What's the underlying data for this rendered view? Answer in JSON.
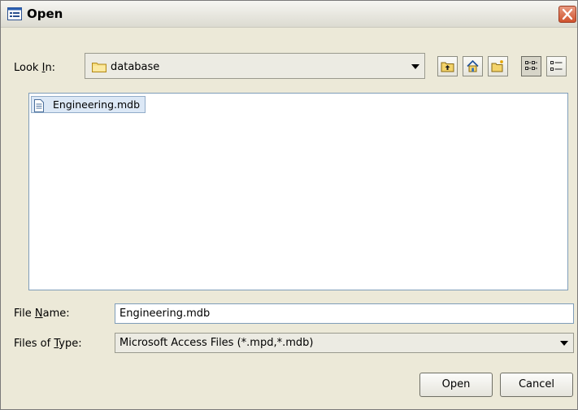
{
  "window": {
    "title": "Open",
    "title_icon": "open-dialog-icon",
    "close_icon": "close-icon"
  },
  "lookin": {
    "label_prefix": "Look ",
    "label_mnemonic": "I",
    "label_suffix": "n:",
    "value": "database",
    "icon": "folder-icon"
  },
  "toolbar": [
    {
      "name": "up-one-level",
      "icon": "up-folder-icon"
    },
    {
      "name": "home",
      "icon": "home-icon"
    },
    {
      "name": "create-new-folder",
      "icon": "new-folder-icon"
    },
    {
      "name": "list-view",
      "icon": "list-view-icon",
      "pressed": true
    },
    {
      "name": "details-view",
      "icon": "details-view-icon",
      "pressed": false
    }
  ],
  "files": [
    {
      "name": "Engineering.mdb",
      "icon": "document-icon",
      "selected": true
    }
  ],
  "filename": {
    "label_prefix": "File ",
    "label_mnemonic": "N",
    "label_suffix": "ame:",
    "value": "Engineering.mdb"
  },
  "filetype": {
    "label_prefix": "Files of ",
    "label_mnemonic": "T",
    "label_suffix": "ype:",
    "value": "Microsoft Access Files (*.mpd,*.mdb)"
  },
  "buttons": {
    "open": "Open",
    "cancel": "Cancel"
  },
  "colors": {
    "dialog_bg": "#ece9d8",
    "selection_bg": "#dce8f6",
    "close_red": "#d0532e",
    "input_border": "#7f9db9"
  }
}
